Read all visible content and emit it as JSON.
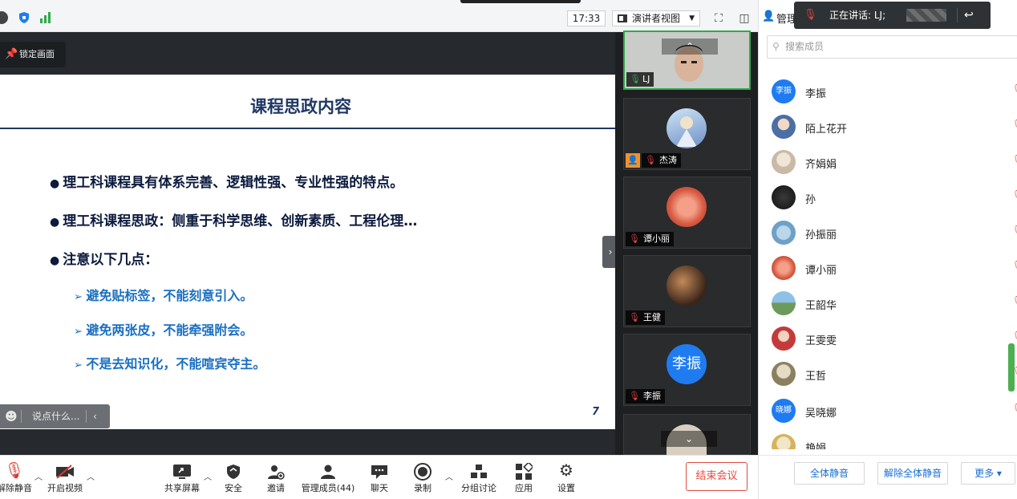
{
  "topbar": {
    "clock": "17:33",
    "view_mode": "演讲者视图"
  },
  "stage": {
    "lock_label": "锁定画面",
    "chat_placeholder": "说点什么..."
  },
  "slide": {
    "title": "课程思政内容",
    "bullets": [
      "理工科课程具有体系完善、逻辑性强、专业性强的特点。",
      "理工科课程思政：侧重于科学思维、创新素质、工程伦理…",
      "注意以下几点："
    ],
    "subbullets": [
      "避免贴标签，不能刻意引入。",
      "避免两张皮，不能牵强附会。",
      "不是去知识化，不能喧宾夺主。"
    ],
    "page_number": "7"
  },
  "video_tiles": [
    {
      "name": "LJ"
    },
    {
      "name": "杰涛"
    },
    {
      "name": "谭小丽"
    },
    {
      "name": "王健"
    },
    {
      "name": "李振",
      "avatar_text": "李振"
    }
  ],
  "speaking": {
    "label": "正在讲话: LJ;"
  },
  "panel": {
    "title": "管理",
    "search_placeholder": "搜索成员",
    "members": [
      {
        "name": "李振",
        "avatar_text": "李振",
        "color": "#1f7cf0"
      },
      {
        "name": "陌上花开",
        "color": "#4a6fa5"
      },
      {
        "name": "齐娟娟",
        "color": "#c9b9a6"
      },
      {
        "name": "孙",
        "color": "#2b2b2b"
      },
      {
        "name": "孙振丽",
        "color": "#6ea0c8"
      },
      {
        "name": "谭小丽",
        "color": "#d9634a"
      },
      {
        "name": "王韶华",
        "color": "#6c9a5a"
      },
      {
        "name": "王雯雯",
        "color": "#c43a3a"
      },
      {
        "name": "王哲",
        "color": "#8a8060"
      },
      {
        "name": "吴晓娜",
        "avatar_text": "晓娜",
        "color": "#1f7cf0"
      },
      {
        "name": "艳娟",
        "color": "#d6b35a"
      }
    ],
    "mute_all": "全体静音",
    "unmute_all": "解除全体静音",
    "more": "更多 ▾"
  },
  "toolbar": {
    "unmute": "解除静音",
    "video": "开启视频",
    "share": "共享屏幕",
    "security": "安全",
    "invite": "邀请",
    "members": "管理成员(44)",
    "chat": "聊天",
    "record": "录制",
    "breakout": "分组讨论",
    "apps": "应用",
    "settings": "设置",
    "end": "结束会议"
  }
}
